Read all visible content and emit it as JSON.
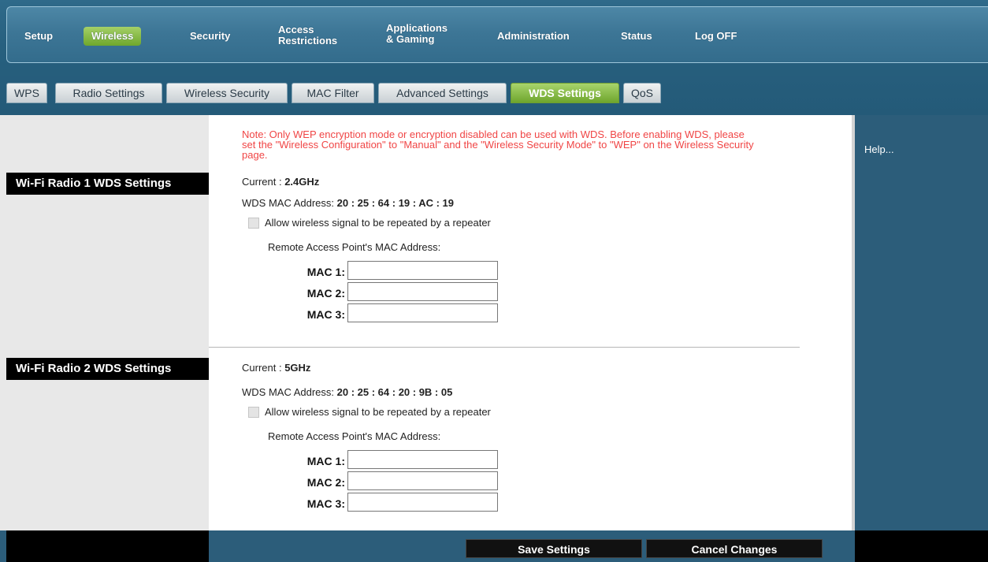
{
  "nav": {
    "items": [
      {
        "label": "Setup"
      },
      {
        "label": "Wireless"
      },
      {
        "label": "Security"
      },
      {
        "label1": "Access",
        "label2": "Restrictions"
      },
      {
        "label1": "Applications",
        "label2": "& Gaming"
      },
      {
        "label": "Administration"
      },
      {
        "label": "Status"
      },
      {
        "label": "Log OFF"
      }
    ]
  },
  "tabs": [
    "WPS",
    "Radio Settings",
    "Wireless Security",
    "MAC Filter",
    "Advanced Settings",
    "WDS Settings",
    "QoS"
  ],
  "active_tab": "WDS Settings",
  "help_label": "Help...",
  "note": "Note: Only WEP encryption mode or encryption disabled can be used with WDS. Before enabling WDS, please set the \"Wireless Configuration\" to \"Manual\" and the \"Wireless Security Mode\" to \"WEP\" on the Wireless Security page.",
  "radio1": {
    "heading": "Wi-Fi Radio 1 WDS Settings",
    "current_label": "Current :",
    "current_value": "2.4GHz",
    "mac_label": "WDS MAC Address:",
    "mac_value": "20 : 25 : 64 : 19 : AC : 19",
    "repeat_label": "Allow wireless signal to be repeated by a repeater",
    "repeat_checked": false,
    "remote_label": "Remote Access Point's MAC Address:",
    "macs": [
      {
        "label": "MAC 1:",
        "value": ""
      },
      {
        "label": "MAC 2:",
        "value": ""
      },
      {
        "label": "MAC 3:",
        "value": ""
      }
    ]
  },
  "radio2": {
    "heading": "Wi-Fi Radio 2 WDS Settings",
    "current_label": "Current :",
    "current_value": "5GHz",
    "mac_label": "WDS MAC Address:",
    "mac_value": "20 : 25 : 64 : 20 : 9B : 05",
    "repeat_label": "Allow wireless signal to be repeated by a repeater",
    "repeat_checked": false,
    "remote_label": "Remote Access Point's MAC Address:",
    "macs": [
      {
        "label": "MAC 1:",
        "value": ""
      },
      {
        "label": "MAC 2:",
        "value": ""
      },
      {
        "label": "MAC 3:",
        "value": ""
      }
    ]
  },
  "buttons": {
    "save": "Save Settings",
    "cancel": "Cancel Changes"
  }
}
